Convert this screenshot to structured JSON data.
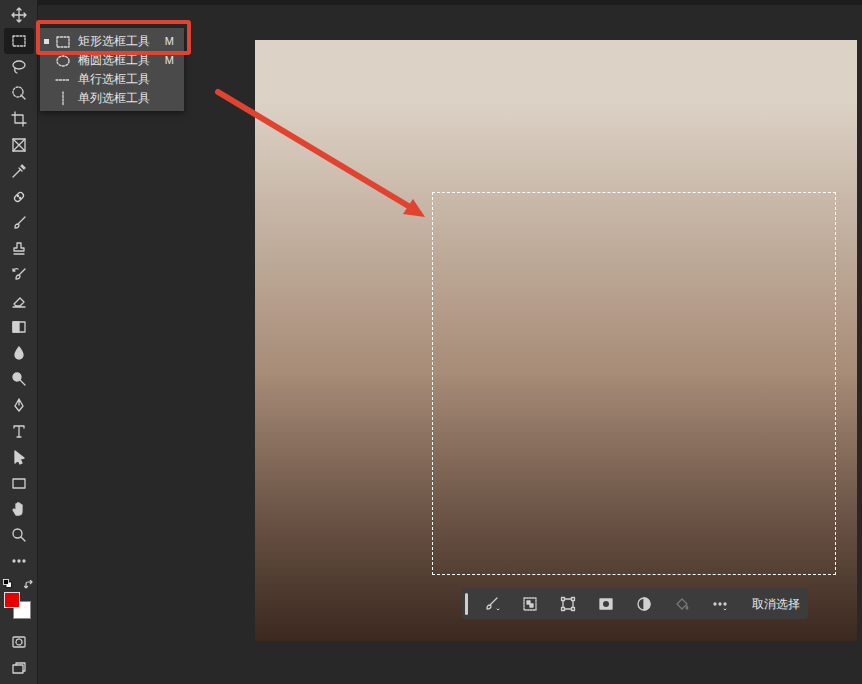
{
  "tools": [
    {
      "kind": "move",
      "selected": false
    },
    {
      "kind": "marquee",
      "selected": true
    },
    {
      "kind": "lasso",
      "selected": false
    },
    {
      "kind": "quick-select",
      "selected": false
    },
    {
      "kind": "crop",
      "selected": false
    },
    {
      "kind": "frame",
      "selected": false
    },
    {
      "kind": "eyedropper",
      "selected": false
    },
    {
      "kind": "healing",
      "selected": false
    },
    {
      "kind": "brush",
      "selected": false
    },
    {
      "kind": "stamp",
      "selected": false
    },
    {
      "kind": "history-brush",
      "selected": false
    },
    {
      "kind": "eraser",
      "selected": false
    },
    {
      "kind": "gradient",
      "selected": false
    },
    {
      "kind": "blur",
      "selected": false
    },
    {
      "kind": "dodge",
      "selected": false
    },
    {
      "kind": "pen",
      "selected": false
    },
    {
      "kind": "type",
      "selected": false
    },
    {
      "kind": "path-select",
      "selected": false
    },
    {
      "kind": "rectangle",
      "selected": false
    },
    {
      "kind": "hand",
      "selected": false
    },
    {
      "kind": "zoom",
      "selected": false
    },
    {
      "kind": "more",
      "selected": false
    }
  ],
  "colors": {
    "foreground": "#e60000",
    "background": "#ffffff"
  },
  "flyout": {
    "items": [
      {
        "label": "矩形选框工具",
        "shortcut": "M",
        "selected": true,
        "kind": "rect"
      },
      {
        "label": "椭圆选框工具",
        "shortcut": "M",
        "selected": false,
        "kind": "ellipse"
      },
      {
        "label": "单行选框工具",
        "selected": false,
        "kind": "row"
      },
      {
        "label": "单列选框工具",
        "selected": false,
        "kind": "column"
      }
    ]
  },
  "taskbar": {
    "tools": [
      {
        "kind": "brush",
        "disabled": false
      },
      {
        "kind": "select-subject",
        "disabled": false
      },
      {
        "kind": "transform",
        "disabled": false
      },
      {
        "kind": "mask",
        "disabled": false
      },
      {
        "kind": "invert",
        "disabled": false
      },
      {
        "kind": "fill",
        "disabled": true
      },
      {
        "kind": "more",
        "disabled": false
      }
    ],
    "button": "取消选择"
  }
}
